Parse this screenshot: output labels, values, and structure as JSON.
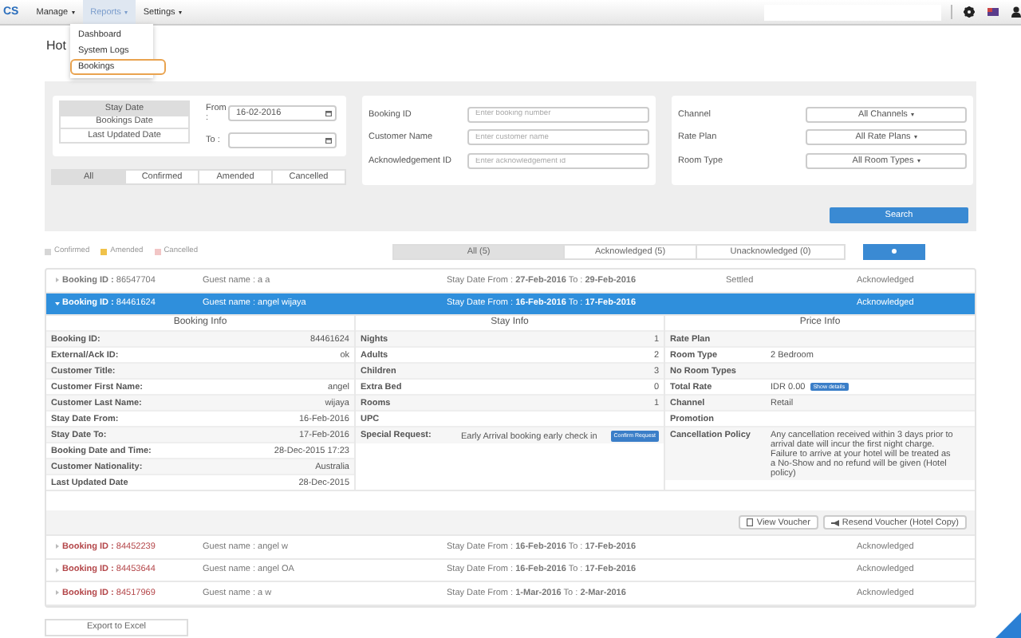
{
  "nav": {
    "logo": "CS",
    "menus": [
      {
        "label": "Manage",
        "selected": false
      },
      {
        "label": "Reports",
        "selected": true
      },
      {
        "label": "Settings",
        "selected": false
      }
    ]
  },
  "dropdown": {
    "items": [
      {
        "label": "Dashboard",
        "selected": false
      },
      {
        "label": "System Logs",
        "selected": false
      },
      {
        "label": "Bookings",
        "selected": true
      }
    ]
  },
  "page_title": "Hot",
  "filters": {
    "date_types": [
      {
        "label": "Stay Date",
        "selected": true
      },
      {
        "label": "Bookings Date",
        "selected": false
      },
      {
        "label": "Last Updated Date",
        "selected": false
      }
    ],
    "from": {
      "label": "From :",
      "value": "16-02-2016"
    },
    "to": {
      "label": "To :"
    },
    "statuses": [
      {
        "label": "All",
        "selected": true
      },
      {
        "label": "Confirmed",
        "selected": false
      },
      {
        "label": "Amended",
        "selected": false
      },
      {
        "label": "Cancelled",
        "selected": false
      }
    ],
    "fields": [
      {
        "label": "Booking ID",
        "placeholder": "Enter booking number"
      },
      {
        "label": "Customer Name",
        "placeholder": "Enter customer name"
      },
      {
        "label": "Acknowledgement ID",
        "placeholder": "Enter acknowledgement id"
      }
    ],
    "selects": [
      {
        "label": "Channel",
        "value": "All Channels"
      },
      {
        "label": "Rate Plan",
        "value": "All Rate Plans"
      },
      {
        "label": "Room Type",
        "value": "All Room Types"
      }
    ],
    "search_button": "Search"
  },
  "legend": [
    {
      "label": "Confirmed",
      "color": "#d6d6d6"
    },
    {
      "label": "Amended",
      "color": "#f0c24a"
    },
    {
      "label": "Cancelled",
      "color": "#f2c6c6"
    }
  ],
  "ack_tabs": [
    {
      "label": "All (5)",
      "selected": true
    },
    {
      "label": "Acknowledged (5)",
      "selected": false
    },
    {
      "label": "Unacknowledged (0)",
      "selected": false
    }
  ],
  "bookings": [
    {
      "id_text": "**Booking ID :** 86547704",
      "color": "#777777",
      "guest": "Guest name : a a",
      "stay": "Stay Date From : **27-Feb-2016** To : **29-Feb-2016**",
      "payment": "Settled",
      "ack": "Acknowledged",
      "selected": false,
      "expanded": false
    },
    {
      "id_text": "**Booking ID :** 84461624",
      "color": "#ffffff",
      "guest": "Guest name : angel wijaya",
      "stay": "Stay Date From : **16-Feb-2016** To : **17-Feb-2016**",
      "ack": "Acknowledged",
      "selected": true,
      "expanded": true,
      "details": {
        "booking_info": {
          "title": "Booking Info",
          "rows": [
            {
              "label": "Booking ID:",
              "value": "84461624"
            },
            {
              "label": "External/Ack ID:",
              "value": "ok"
            },
            {
              "label": "Customer Title:"
            },
            {
              "label": "Customer First Name:",
              "value": "angel"
            },
            {
              "label": "Customer Last Name:",
              "value": "wijaya"
            },
            {
              "label": "Stay Date From:",
              "value": "16-Feb-2016"
            },
            {
              "label": "Stay Date To:",
              "value": "17-Feb-2016"
            },
            {
              "label": "Booking Date and Time:",
              "value": "28-Dec-2015 17:23"
            },
            {
              "label": "Customer Nationality:",
              "value": "Australia"
            },
            {
              "label": "Last Updated Date",
              "value": "28-Dec-2015"
            }
          ]
        },
        "stay_info": {
          "title": "Stay Info",
          "rows": [
            {
              "kind": "count",
              "label": "Nights",
              "value": "1"
            },
            {
              "kind": "count",
              "label": "Adults",
              "value": "2"
            },
            {
              "kind": "count",
              "label": "Children",
              "value": "3"
            },
            {
              "kind": "count",
              "label": "Extra Bed",
              "value": "0"
            },
            {
              "kind": "count",
              "label": "Rooms",
              "value": "1"
            },
            {
              "kind": "count",
              "label": "UPC"
            },
            {
              "kind": "note",
              "label": "Special Request:",
              "value": "Early Arrival booking early check in",
              "badge": "Confirm Request"
            }
          ]
        },
        "price_info": {
          "title": "Price Info",
          "rows": [
            {
              "label": "Rate Plan"
            },
            {
              "label": "Room Type",
              "value": "2 Bedroom"
            },
            {
              "label": "No Room Types"
            },
            {
              "label": "Total Rate",
              "value": "IDR 0.00",
              "badge": "Show details"
            },
            {
              "label": "Channel",
              "value": "Retail"
            },
            {
              "label": "Promotion"
            },
            {
              "label": "Cancellation Policy",
              "value": "Any cancellation received within 3 days prior to arrival date will incur the first night charge. Failure to arrive at your hotel will be treated as a No-Show and no refund will be given (Hotel policy)"
            }
          ]
        },
        "buttons": [
          {
            "kind": "view",
            "label": "View Voucher"
          },
          {
            "kind": "resend",
            "label": "Resend Voucher (Hotel Copy)"
          }
        ]
      }
    },
    {
      "id_text": "**Booking ID :** 84452239",
      "color": "#b4474a",
      "guest": "Guest name : angel w",
      "stay": "Stay Date From : **16-Feb-2016** To : **17-Feb-2016**",
      "ack": "Acknowledged",
      "selected": false,
      "expanded": false
    },
    {
      "id_text": "**Booking ID :** 84453644",
      "color": "#b4474a",
      "guest": "Guest name : angel OA",
      "stay": "Stay Date From : **16-Feb-2016** To : **17-Feb-2016**",
      "ack": "Acknowledged",
      "selected": false,
      "expanded": false
    },
    {
      "id_text": "**Booking ID :** 84517969",
      "color": "#b4474a",
      "guest": "Guest name : a w",
      "stay": "Stay Date From : **1-Mar-2016** To : **2-Mar-2016**",
      "ack": "Acknowledged",
      "selected": false,
      "expanded": false
    }
  ],
  "export_button": "Export to Excel"
}
